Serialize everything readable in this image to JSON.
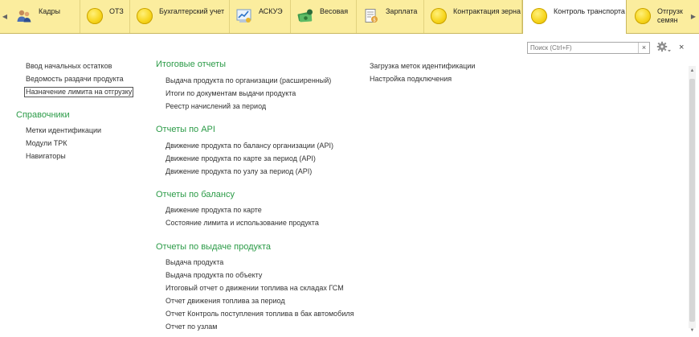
{
  "sections_bar": {
    "tabs": [
      {
        "label": "Кадры",
        "icon": "users-icon"
      },
      {
        "label": "ОТЗ",
        "icon": "yellow-circle-icon"
      },
      {
        "label": "Бухгалтерский учет",
        "icon": "yellow-circle-icon"
      },
      {
        "label": "АСКУЭ",
        "icon": "chart-icon"
      },
      {
        "label": "Весовая",
        "icon": "money-icon"
      },
      {
        "label": "Зарплата",
        "icon": "document-icon"
      },
      {
        "label": "Контрактация зерна",
        "icon": "yellow-circle-icon"
      },
      {
        "label": "Контроль транспорта",
        "icon": "yellow-circle-icon",
        "active": true
      },
      {
        "label": "Отгрузка семян",
        "icon": "yellow-circle-icon"
      }
    ],
    "accent_color": "#fbed9e",
    "active_color": "#ffffff"
  },
  "toolbar": {
    "search_placeholder": "Поиск (Ctrl+F)",
    "clear_symbol": "×",
    "close_symbol": "×"
  },
  "content": {
    "column1": {
      "items": [
        "Ввод начальных остатков",
        "Ведомость раздачи продукта",
        "Назначение лимита на отгрузку"
      ],
      "reference_header": "Справочники",
      "reference_items": [
        "Метки идентификации",
        "Модули ТРК",
        "Навигаторы"
      ]
    },
    "column2": {
      "groups": [
        {
          "title": "Итоговые отчеты",
          "items": [
            "Выдача продукта по организации (расширенный)",
            "Итоги по документам выдачи продукта",
            "Реестр начислений за период"
          ]
        },
        {
          "title": "Отчеты по API",
          "items": [
            "Движение продукта по балансу организации (API)",
            "Движение продукта по карте за период (API)",
            "Движение продукта по узлу за период (API)"
          ]
        },
        {
          "title": "Отчеты по балансу",
          "items": [
            "Движение продукта по карте",
            "Состояние лимита и использование продукта"
          ]
        },
        {
          "title": "Отчеты по выдаче продукта",
          "items": [
            "Выдача продукта",
            "Выдача продукта по объекту",
            "Итоговый отчет о движении топлива на складах ГСМ",
            "Отчет движения топлива за период",
            "Отчет Контроль поступления топлива в бак автомобиля",
            "Отчет по узлам"
          ]
        }
      ]
    },
    "column3": {
      "items": [
        "Загрузка меток идентификации",
        "Настройка подключения"
      ]
    },
    "header_color": "#2b9b47"
  }
}
